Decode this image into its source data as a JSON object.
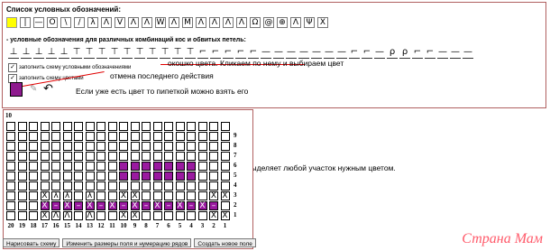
{
  "panel": {
    "title": "Список условных обозначений:",
    "symbols_row1": [
      "",
      "|",
      "—",
      "O",
      "\\",
      "/",
      "λ",
      "Λ",
      "V",
      "Λ",
      "Λ",
      "W",
      "Λ",
      "M",
      "Λ",
      "Λ",
      "Λ",
      "Λ",
      "Ω",
      "@",
      "⊕",
      "Λ",
      "Ψ",
      "X"
    ],
    "combo_title": "- условные обозначения для различных комбинаций кос и обвитых петель:",
    "symbols_row2": [
      "⊥",
      "⊥",
      "⊥",
      "⊥",
      "⊥",
      "⊤",
      "⊤",
      "⊤",
      "⊤",
      "⊤",
      "⊤",
      "⊤",
      "⊤",
      "⊤",
      "⊤",
      "⌐",
      "⌐",
      "⌐",
      "⌐",
      "⌐",
      "—",
      "—",
      "—",
      "—",
      "—",
      "—",
      "—",
      "⌐",
      "⌐",
      "—",
      "ρ",
      "ρ",
      "⌐",
      "⌐",
      "—",
      "—",
      "—"
    ],
    "checkbox1": "заполнить схему условными обозначениями",
    "checkbox2": "заполнить схему цветами"
  },
  "annotations": {
    "color_window": "окошко цвета. Кликаем по нему и выбираем цвет",
    "undo": "отмена последнего действия",
    "pipette": "Если уже есть цвет то пипеткой можно взять его",
    "select": "выделяет любой участок нужным цветом."
  },
  "colors": {
    "fill": "#9a1aa0",
    "accent_red": "#e00000"
  },
  "grid": {
    "top_label": "10",
    "row_numbers": [
      "9",
      "8",
      "7",
      "6",
      "5",
      "4",
      "3",
      "2",
      "1"
    ],
    "col_numbers": [
      "20",
      "19",
      "18",
      "17",
      "16",
      "15",
      "14",
      "13",
      "12",
      "11",
      "10",
      "9",
      "8",
      "7",
      "6",
      "5",
      "4",
      "3",
      "2",
      "1"
    ]
  },
  "buttons": {
    "draw": "Нарисовать схему",
    "resize": "Изменить размеры поля и нумерацию рядов",
    "new": "Создать новое поле"
  },
  "logo": "Страна Мам"
}
